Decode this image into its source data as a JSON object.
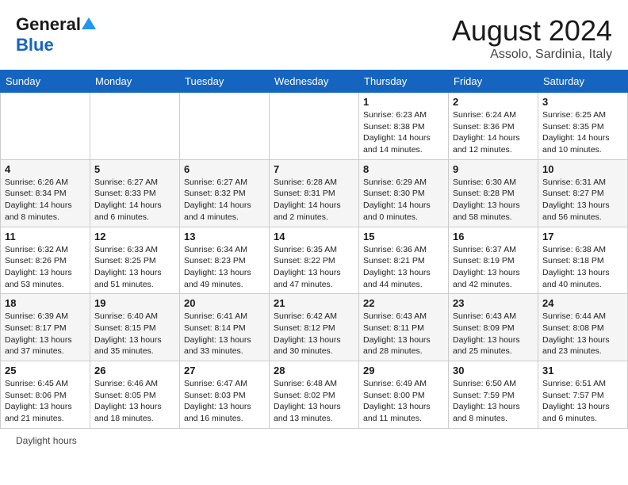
{
  "header": {
    "logo_general": "General",
    "logo_blue": "Blue",
    "month_year": "August 2024",
    "location": "Assolo, Sardinia, Italy"
  },
  "weekdays": [
    "Sunday",
    "Monday",
    "Tuesday",
    "Wednesday",
    "Thursday",
    "Friday",
    "Saturday"
  ],
  "weeks": [
    [
      {
        "day": "",
        "info": ""
      },
      {
        "day": "",
        "info": ""
      },
      {
        "day": "",
        "info": ""
      },
      {
        "day": "",
        "info": ""
      },
      {
        "day": "1",
        "info": "Sunrise: 6:23 AM\nSunset: 8:38 PM\nDaylight: 14 hours and 14 minutes."
      },
      {
        "day": "2",
        "info": "Sunrise: 6:24 AM\nSunset: 8:36 PM\nDaylight: 14 hours and 12 minutes."
      },
      {
        "day": "3",
        "info": "Sunrise: 6:25 AM\nSunset: 8:35 PM\nDaylight: 14 hours and 10 minutes."
      }
    ],
    [
      {
        "day": "4",
        "info": "Sunrise: 6:26 AM\nSunset: 8:34 PM\nDaylight: 14 hours and 8 minutes."
      },
      {
        "day": "5",
        "info": "Sunrise: 6:27 AM\nSunset: 8:33 PM\nDaylight: 14 hours and 6 minutes."
      },
      {
        "day": "6",
        "info": "Sunrise: 6:27 AM\nSunset: 8:32 PM\nDaylight: 14 hours and 4 minutes."
      },
      {
        "day": "7",
        "info": "Sunrise: 6:28 AM\nSunset: 8:31 PM\nDaylight: 14 hours and 2 minutes."
      },
      {
        "day": "8",
        "info": "Sunrise: 6:29 AM\nSunset: 8:30 PM\nDaylight: 14 hours and 0 minutes."
      },
      {
        "day": "9",
        "info": "Sunrise: 6:30 AM\nSunset: 8:28 PM\nDaylight: 13 hours and 58 minutes."
      },
      {
        "day": "10",
        "info": "Sunrise: 6:31 AM\nSunset: 8:27 PM\nDaylight: 13 hours and 56 minutes."
      }
    ],
    [
      {
        "day": "11",
        "info": "Sunrise: 6:32 AM\nSunset: 8:26 PM\nDaylight: 13 hours and 53 minutes."
      },
      {
        "day": "12",
        "info": "Sunrise: 6:33 AM\nSunset: 8:25 PM\nDaylight: 13 hours and 51 minutes."
      },
      {
        "day": "13",
        "info": "Sunrise: 6:34 AM\nSunset: 8:23 PM\nDaylight: 13 hours and 49 minutes."
      },
      {
        "day": "14",
        "info": "Sunrise: 6:35 AM\nSunset: 8:22 PM\nDaylight: 13 hours and 47 minutes."
      },
      {
        "day": "15",
        "info": "Sunrise: 6:36 AM\nSunset: 8:21 PM\nDaylight: 13 hours and 44 minutes."
      },
      {
        "day": "16",
        "info": "Sunrise: 6:37 AM\nSunset: 8:19 PM\nDaylight: 13 hours and 42 minutes."
      },
      {
        "day": "17",
        "info": "Sunrise: 6:38 AM\nSunset: 8:18 PM\nDaylight: 13 hours and 40 minutes."
      }
    ],
    [
      {
        "day": "18",
        "info": "Sunrise: 6:39 AM\nSunset: 8:17 PM\nDaylight: 13 hours and 37 minutes."
      },
      {
        "day": "19",
        "info": "Sunrise: 6:40 AM\nSunset: 8:15 PM\nDaylight: 13 hours and 35 minutes."
      },
      {
        "day": "20",
        "info": "Sunrise: 6:41 AM\nSunset: 8:14 PM\nDaylight: 13 hours and 33 minutes."
      },
      {
        "day": "21",
        "info": "Sunrise: 6:42 AM\nSunset: 8:12 PM\nDaylight: 13 hours and 30 minutes."
      },
      {
        "day": "22",
        "info": "Sunrise: 6:43 AM\nSunset: 8:11 PM\nDaylight: 13 hours and 28 minutes."
      },
      {
        "day": "23",
        "info": "Sunrise: 6:43 AM\nSunset: 8:09 PM\nDaylight: 13 hours and 25 minutes."
      },
      {
        "day": "24",
        "info": "Sunrise: 6:44 AM\nSunset: 8:08 PM\nDaylight: 13 hours and 23 minutes."
      }
    ],
    [
      {
        "day": "25",
        "info": "Sunrise: 6:45 AM\nSunset: 8:06 PM\nDaylight: 13 hours and 21 minutes."
      },
      {
        "day": "26",
        "info": "Sunrise: 6:46 AM\nSunset: 8:05 PM\nDaylight: 13 hours and 18 minutes."
      },
      {
        "day": "27",
        "info": "Sunrise: 6:47 AM\nSunset: 8:03 PM\nDaylight: 13 hours and 16 minutes."
      },
      {
        "day": "28",
        "info": "Sunrise: 6:48 AM\nSunset: 8:02 PM\nDaylight: 13 hours and 13 minutes."
      },
      {
        "day": "29",
        "info": "Sunrise: 6:49 AM\nSunset: 8:00 PM\nDaylight: 13 hours and 11 minutes."
      },
      {
        "day": "30",
        "info": "Sunrise: 6:50 AM\nSunset: 7:59 PM\nDaylight: 13 hours and 8 minutes."
      },
      {
        "day": "31",
        "info": "Sunrise: 6:51 AM\nSunset: 7:57 PM\nDaylight: 13 hours and 6 minutes."
      }
    ]
  ],
  "footer": {
    "daylight_label": "Daylight hours"
  }
}
